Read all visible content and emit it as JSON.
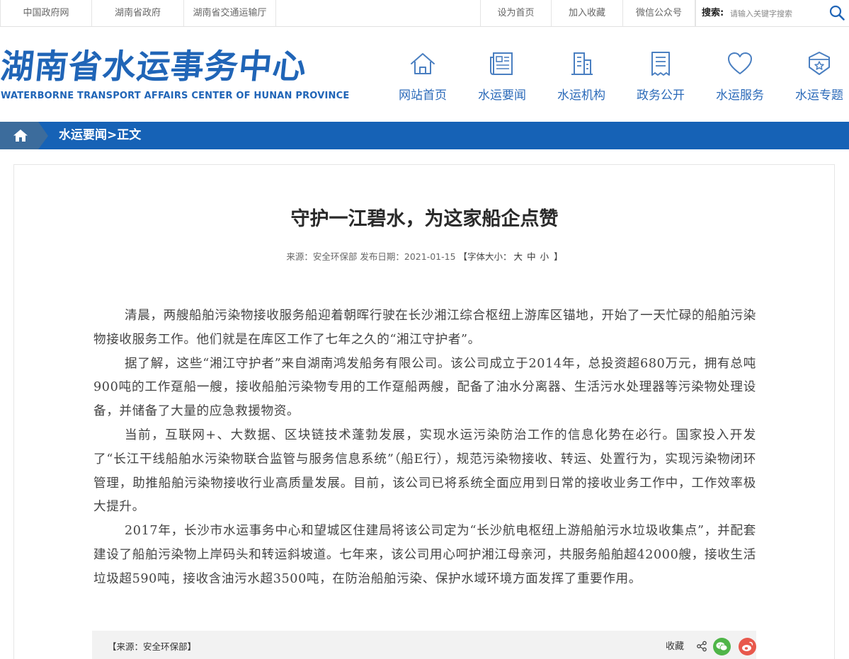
{
  "topbar": {
    "links": [
      "中国政府网",
      "湖南省政府",
      "湖南省交通运输厅"
    ],
    "right_links": [
      "设为首页",
      "加入收藏",
      "微信公众号"
    ],
    "search_label": "搜索:",
    "search_placeholder": "请输入关键字搜索"
  },
  "header": {
    "logo_cn": "湖南省水运事务中心",
    "logo_en": "WATERBORNE TRANSPORT AFFAIRS CENTER OF HUNAN PROVINCE",
    "nav": [
      {
        "label": "网站首页",
        "icon": "home-icon"
      },
      {
        "label": "水运要闻",
        "icon": "newspaper-icon"
      },
      {
        "label": "水运机构",
        "icon": "building-icon"
      },
      {
        "label": "政务公开",
        "icon": "document-icon"
      },
      {
        "label": "水运服务",
        "icon": "heart-icon"
      },
      {
        "label": "水运专题",
        "icon": "star-badge-icon"
      }
    ]
  },
  "breadcrumb": {
    "path": "水运要闻>正文"
  },
  "article": {
    "title": "守护一江碧水，为这家船企点赞",
    "meta": {
      "source": "来源：安全环保部 发布日期：2021-01-15",
      "font_size_label": "【字体大小：",
      "large": "大",
      "medium": "中",
      "small": "小",
      "close": " 】"
    },
    "paragraphs": [
      "清晨，两艘船舶污染物接收服务船迎着朝晖行驶在长沙湘江综合枢纽上游库区锚地，开始了一天忙碌的船舶污染物接收服务工作。他们就是在库区工作了七年之久的“湘江守护者”。",
      "据了解，这些“湘江守护者”来自湖南鸿发船务有限公司。该公司成立于2014年，总投资超680万元，拥有总吨900吨的工作趸船一艘，接收船舶污染物专用的工作趸船两艘，配备了油水分离器、生活污水处理器等污染物处理设备，并储备了大量的应急救援物资。",
      "当前，互联网+、大数据、区块链技术蓬勃发展，实现水运污染防治工作的信息化势在必行。国家投入开发了“长江干线船舶水污染物联合监管与服务信息系统”（船E行），规范污染物接收、转运、处置行为，实现污染物闭环管理，助推船舶污染物接收行业高质量发展。目前，该公司已将系统全面应用到日常的接收业务工作中，工作效率极大提升。",
      "2017年，长沙市水运事务中心和望城区住建局将该公司定为“长沙航电枢纽上游船舶污水垃圾收集点”，并配套建设了船舶污染物上岸码头和转运斜坡道。七年来，该公司用心呵护湘江母亲河，共服务船舶超42000艘，接收生活垃圾超590吨，接收含油污水超3500吨，在防治船舶污染、保护水域环境方面发挥了重要作用。"
    ],
    "footer": {
      "source": "【来源：安全环保部】",
      "favorite": "收藏"
    }
  },
  "colors": {
    "brand_blue": "#1662b6",
    "home_block": "#3c6c9c",
    "wechat_green": "#4fb548",
    "weibo_red": "#e8584c"
  }
}
